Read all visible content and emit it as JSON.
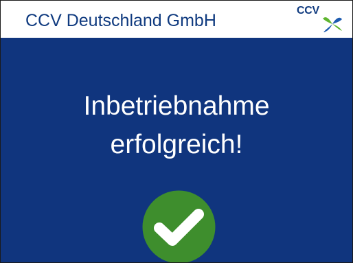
{
  "header": {
    "title": "CCV Deutschland GmbH",
    "logo_text": "CCV"
  },
  "message": {
    "line1": "Inbetriebnahme",
    "line2": "erfolgreich!"
  },
  "status": {
    "icon": "success-checkmark-icon"
  },
  "colors": {
    "background": "#10357e",
    "header_background": "#ffffff",
    "title_text": "#0f3a7f",
    "message_text": "#ffffff",
    "success_green": "#3e8e2d",
    "logo_green": "#5eb52f",
    "logo_blue": "#1d5bb0"
  }
}
